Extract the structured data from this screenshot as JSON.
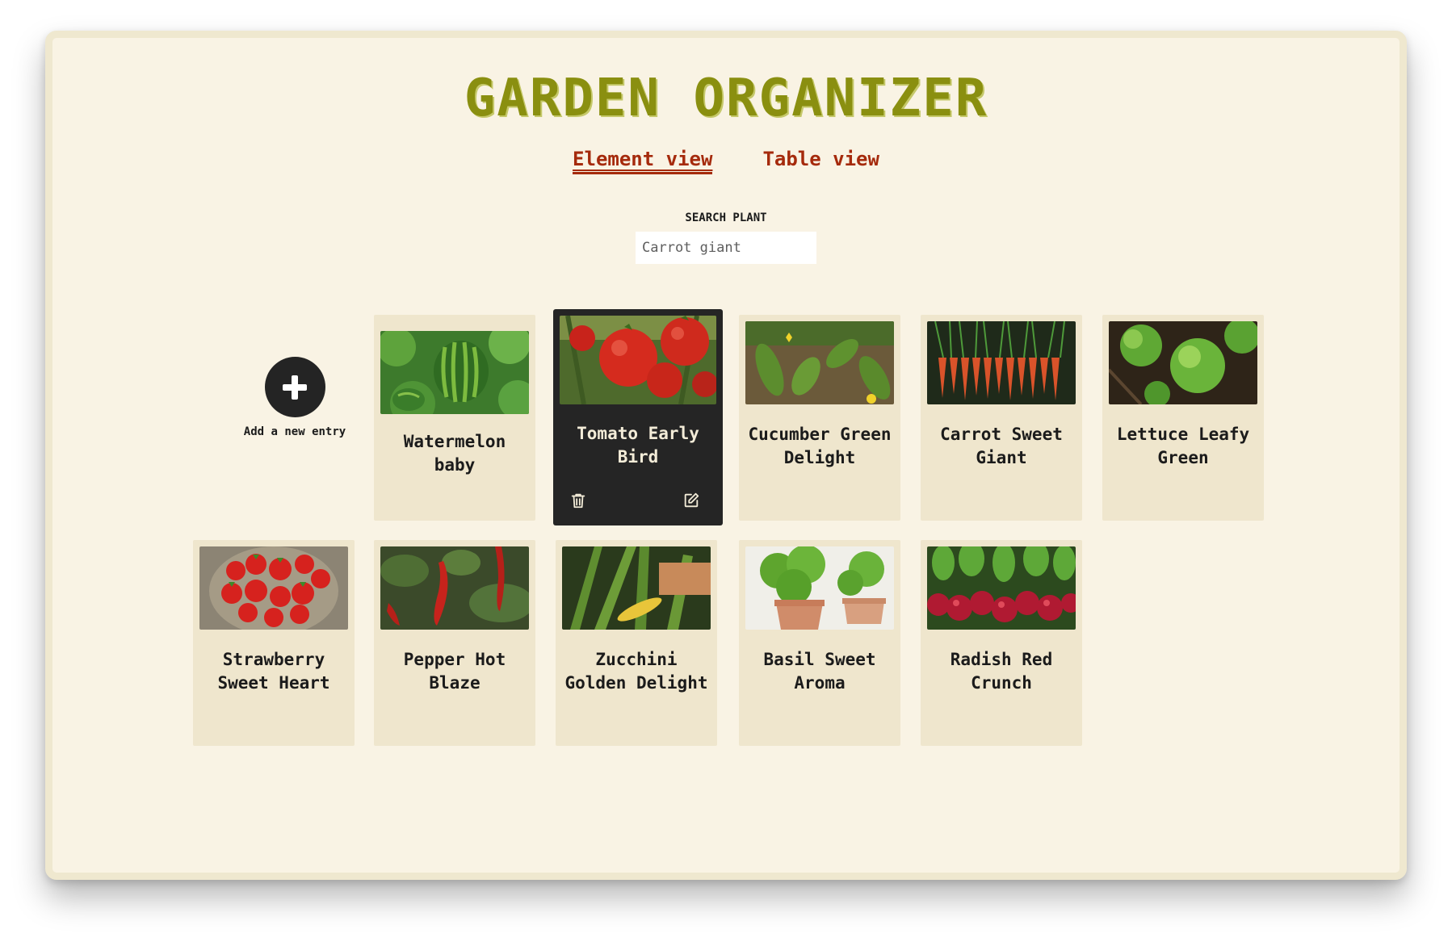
{
  "app": {
    "title": "GARDEN ORGANIZER"
  },
  "tabs": [
    {
      "label": "Element view",
      "active": true
    },
    {
      "label": "Table view",
      "active": false
    }
  ],
  "search": {
    "label": "SEARCH PLANT",
    "placeholder": "Carrot giant",
    "value": ""
  },
  "add_entry": {
    "label": "Add a new entry",
    "icon": "plus-icon"
  },
  "plants": [
    {
      "name": "Watermelon baby",
      "image": "watermelon-photo"
    },
    {
      "name": "Tomato Early Bird",
      "image": "tomato-photo",
      "selected": true
    },
    {
      "name": "Cucumber Green Delight",
      "image": "cucumber-photo"
    },
    {
      "name": "Carrot Sweet Giant",
      "image": "carrot-photo"
    },
    {
      "name": "Lettuce Leafy Green",
      "image": "lettuce-photo"
    },
    {
      "name": "Strawberry Sweet Heart",
      "image": "strawberry-photo"
    },
    {
      "name": "Pepper Hot Blaze",
      "image": "pepper-photo"
    },
    {
      "name": "Zucchini Golden Delight",
      "image": "zucchini-photo"
    },
    {
      "name": "Basil Sweet Aroma",
      "image": "basil-photo"
    },
    {
      "name": "Radish Red Crunch",
      "image": "radish-photo"
    }
  ],
  "card_actions": {
    "delete_icon": "trash-icon",
    "edit_icon": "edit-icon"
  },
  "colors": {
    "background": "#f9f3e4",
    "card": "#efe6cd",
    "card_selected": "#252525",
    "title": "#8a8f10",
    "tab": "#a52a0c"
  }
}
